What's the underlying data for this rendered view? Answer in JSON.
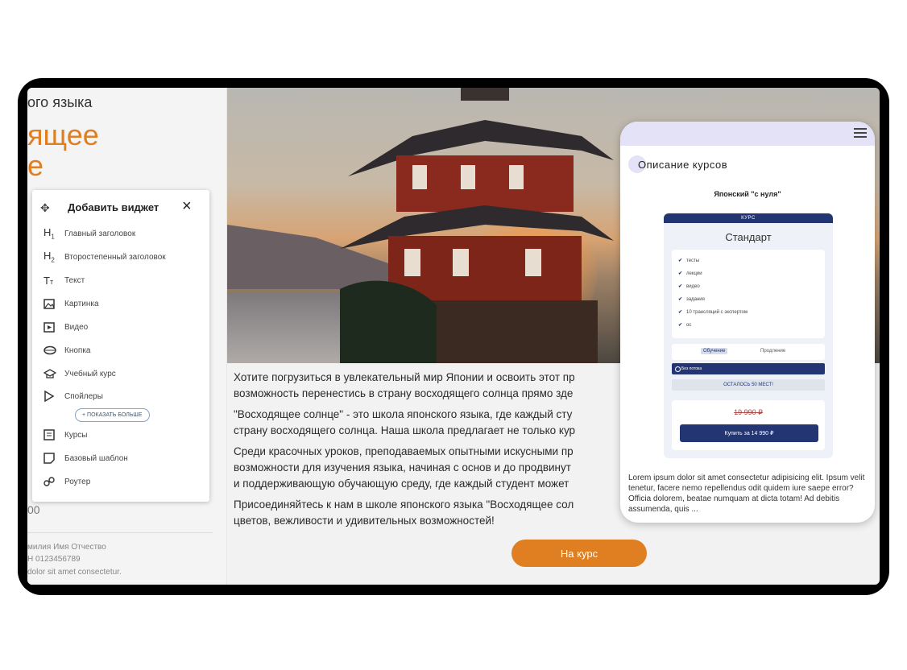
{
  "left_page": {
    "subtitle": "ого языка",
    "hero_line1": "ящее",
    "hero_line2": "е",
    "price_fragment": "00",
    "footer_name": "милия Имя Отчество",
    "footer_inn": "Н 0123456789",
    "footer_lorem": "dolor sit amet consectetur."
  },
  "widget_panel": {
    "title": "Добавить виджет",
    "close_icon": "×",
    "items": [
      {
        "icon": "H1",
        "label": "Главный заголовок"
      },
      {
        "icon": "H2",
        "label": "Второстепенный заголовок"
      },
      {
        "icon": "Tт",
        "label": "Текст"
      },
      {
        "icon": "image-icon",
        "label": "Картинка"
      },
      {
        "icon": "video-icon",
        "label": "Видео"
      },
      {
        "icon": "button-icon",
        "label": "Кнопка"
      },
      {
        "icon": "graduation-cap-icon",
        "label": "Учебный курс"
      },
      {
        "icon": "play-triangle-icon",
        "label": "Спойлеры"
      }
    ],
    "show_more": "+ ПОКАЗАТЬ БОЛЬШЕ",
    "items_after": [
      {
        "icon": "courses-icon",
        "label": "Курсы"
      },
      {
        "icon": "template-icon",
        "label": "Базовый шаблон"
      },
      {
        "icon": "link-icon",
        "label": "Роутер"
      }
    ]
  },
  "main": {
    "paragraphs": [
      "Хотите погрузиться в увлекательный мир Японии и освоить этот пр",
      "возможность перенестись в страну восходящего солнца прямо зде",
      "\"Восходящее солнце\" - это школа японского языка, где каждый сту",
      "страну восходящего солнца. Наша школа предлагает не только кур",
      "Среди красочных уроков, преподаваемых опытными искусными пр",
      "возможности для изучения языка, начиная с основ и до продвинут",
      "и поддерживающую обучающую среду, где каждый студент может",
      "Присоединяйтесь к нам в школе японского языка \"Восходящее сол",
      "цветов, вежливости и удивительных возможностей!"
    ],
    "cta_label": "На курс"
  },
  "phone": {
    "section_title": "Описание курсов",
    "course_name": "Японский \"с нуля\"",
    "card_header": "КУРС",
    "plan_name": "Стандарт",
    "features": [
      "тесты",
      "лекции",
      "видео",
      "задания",
      "10 трансляций с экспертом",
      "ос"
    ],
    "tab_active": "Обучение",
    "tab_other": "Продление",
    "option_label": "Без потока",
    "seats_left": "ОСТАЛОСЬ 50 МЕСТ!",
    "old_price": "19 990 ₽",
    "buy_label": "Купить за 14 990 ₽",
    "lorem": "Lorem ipsum dolor sit amet consectetur adipisicing elit. Ipsum velit tenetur, facere nemo repellendus odit quidem iure saepe error? Officia dolorem, beatae numquam at dicta totam! Ad debitis assumenda, quis ..."
  }
}
